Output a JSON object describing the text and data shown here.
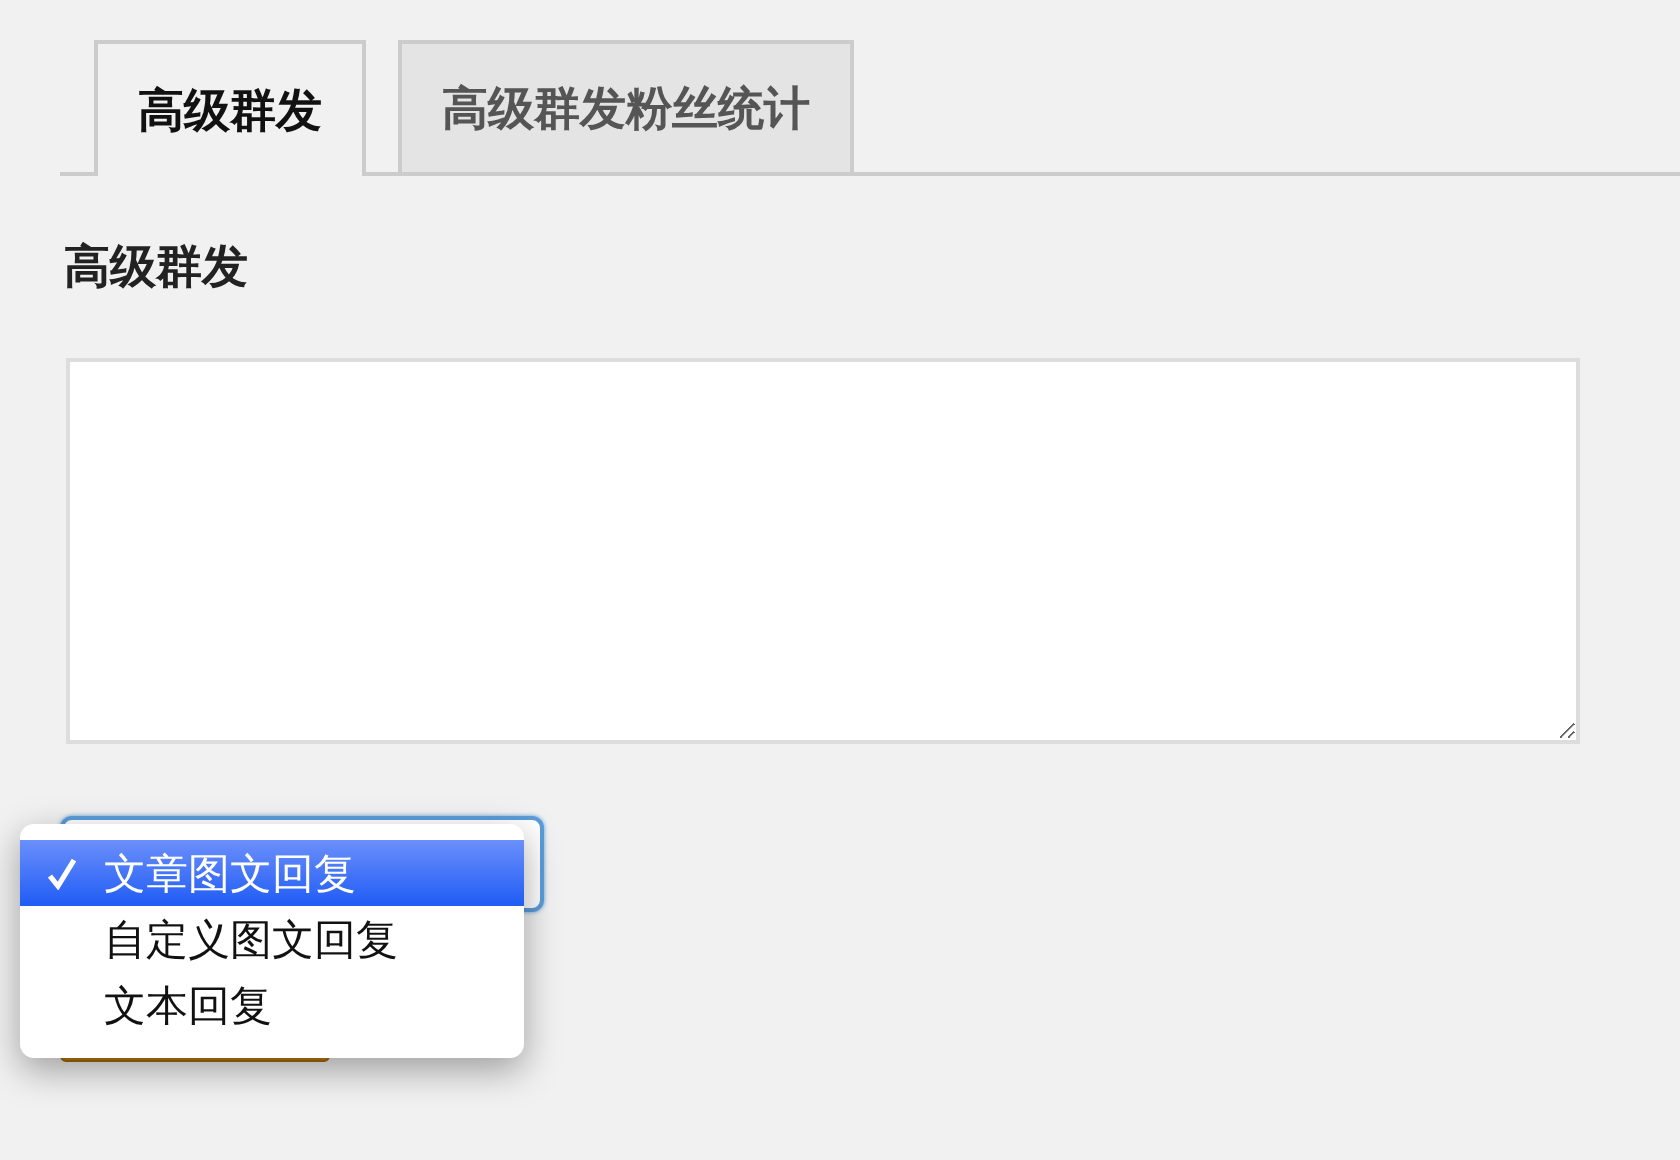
{
  "tabs": [
    {
      "label": "高级群发",
      "selected": true
    },
    {
      "label": "高级群发粉丝统计",
      "selected": false
    }
  ],
  "heading": "高级群发",
  "type_select": {
    "focused": true
  },
  "dropdown_menu": {
    "options": [
      {
        "label": "文章图文回复",
        "selected": true
      },
      {
        "label": "自定义图文回复",
        "selected": false
      },
      {
        "label": "文本回复",
        "selected": false
      }
    ]
  }
}
